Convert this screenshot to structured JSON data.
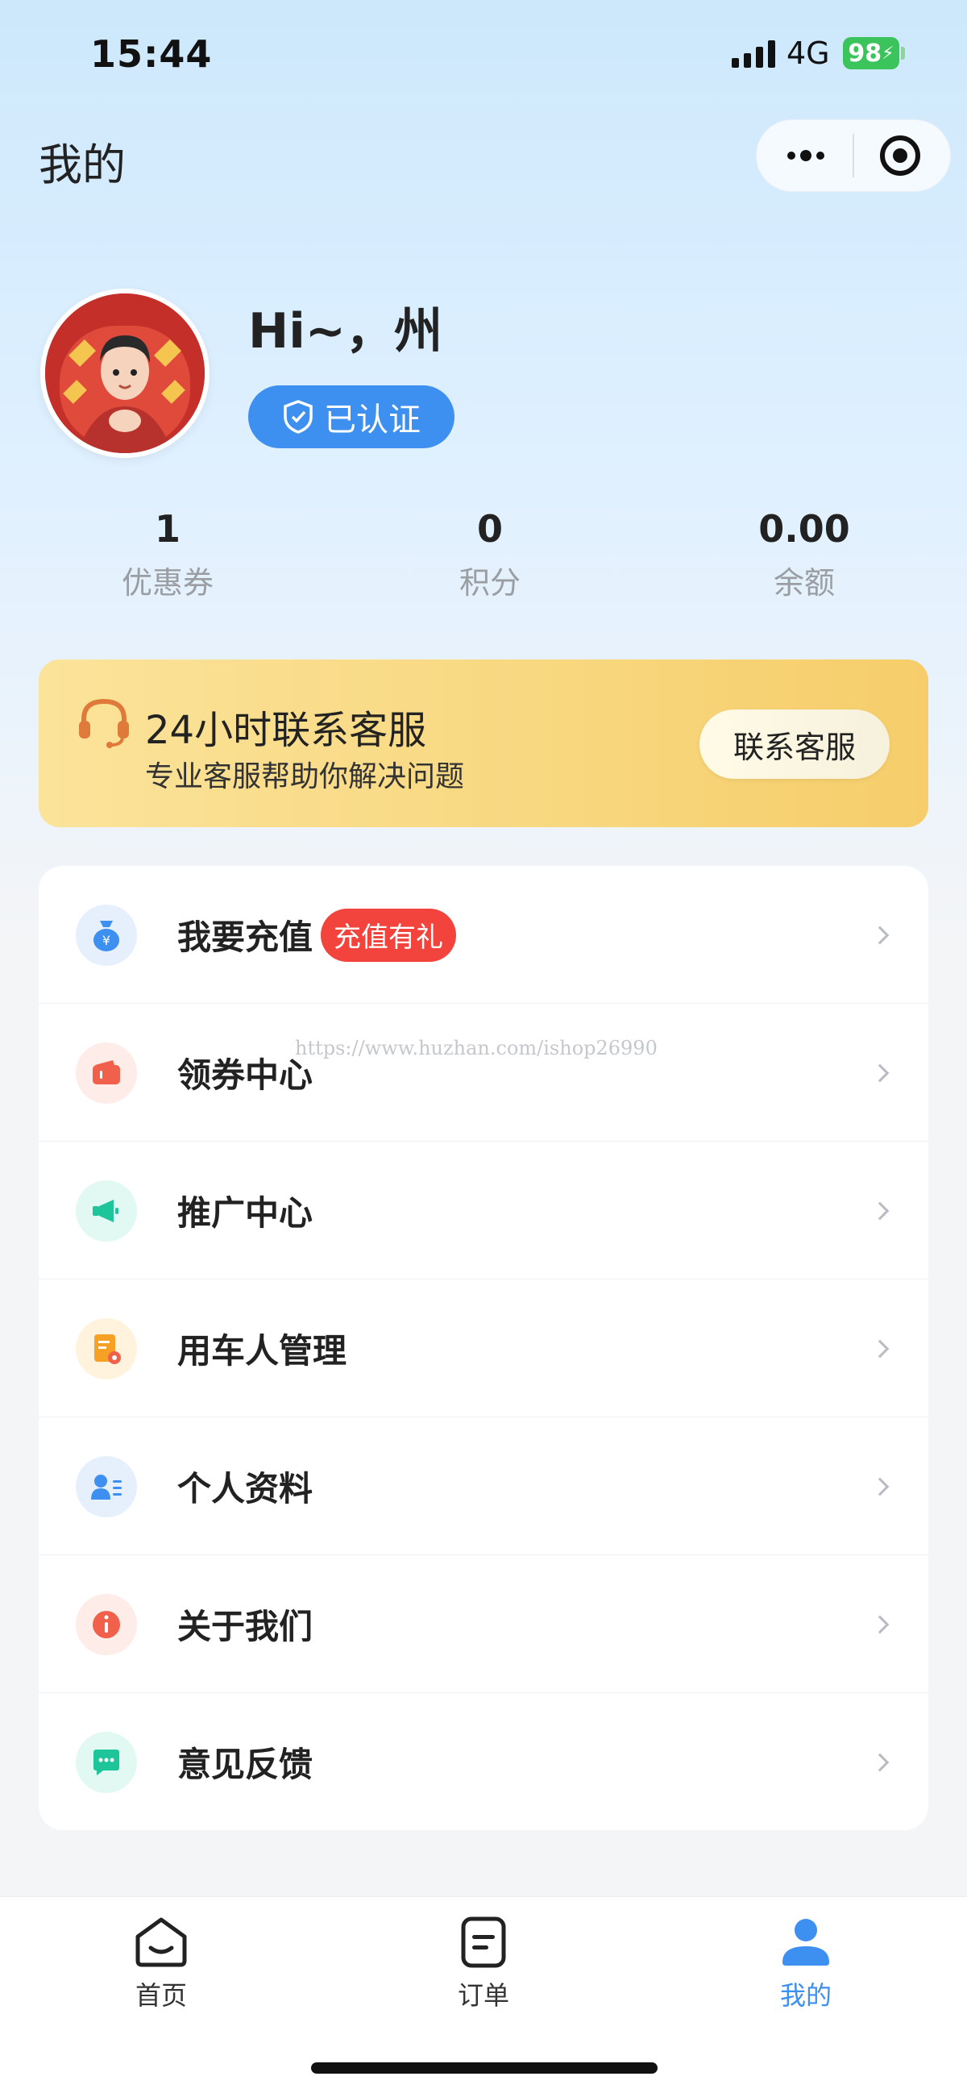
{
  "status_bar": {
    "time": "15:44",
    "network": "4G",
    "battery": "98"
  },
  "header": {
    "title": "我的"
  },
  "profile": {
    "greeting": "Hi~，州",
    "verified_label": "已认证"
  },
  "stats": [
    {
      "value": "1",
      "label": "优惠券"
    },
    {
      "value": "0",
      "label": "积分"
    },
    {
      "value": "0.00",
      "label": "余额"
    }
  ],
  "service": {
    "title": "24小时联系客服",
    "subtitle": "专业客服帮助你解决问题",
    "button": "联系客服"
  },
  "menu": [
    {
      "label": "我要充值",
      "badge": "充值有礼",
      "icon": "money-bag-icon"
    },
    {
      "label": "领券中心",
      "icon": "wallet-icon"
    },
    {
      "label": "推广中心",
      "icon": "megaphone-icon"
    },
    {
      "label": "用车人管理",
      "icon": "document-gear-icon"
    },
    {
      "label": "个人资料",
      "icon": "user-profile-icon"
    },
    {
      "label": "关于我们",
      "icon": "info-icon"
    },
    {
      "label": "意见反馈",
      "icon": "chat-bubble-icon"
    }
  ],
  "watermark": "https://www.huzhan.com/ishop26990",
  "tabs": [
    {
      "label": "首页",
      "icon": "home-icon"
    },
    {
      "label": "订单",
      "icon": "order-icon"
    },
    {
      "label": "我的",
      "icon": "user-icon",
      "active": true
    }
  ],
  "colors": {
    "accent": "#3d8ff0",
    "badge": "#f2443d",
    "service_banner": "#f8d77e"
  }
}
